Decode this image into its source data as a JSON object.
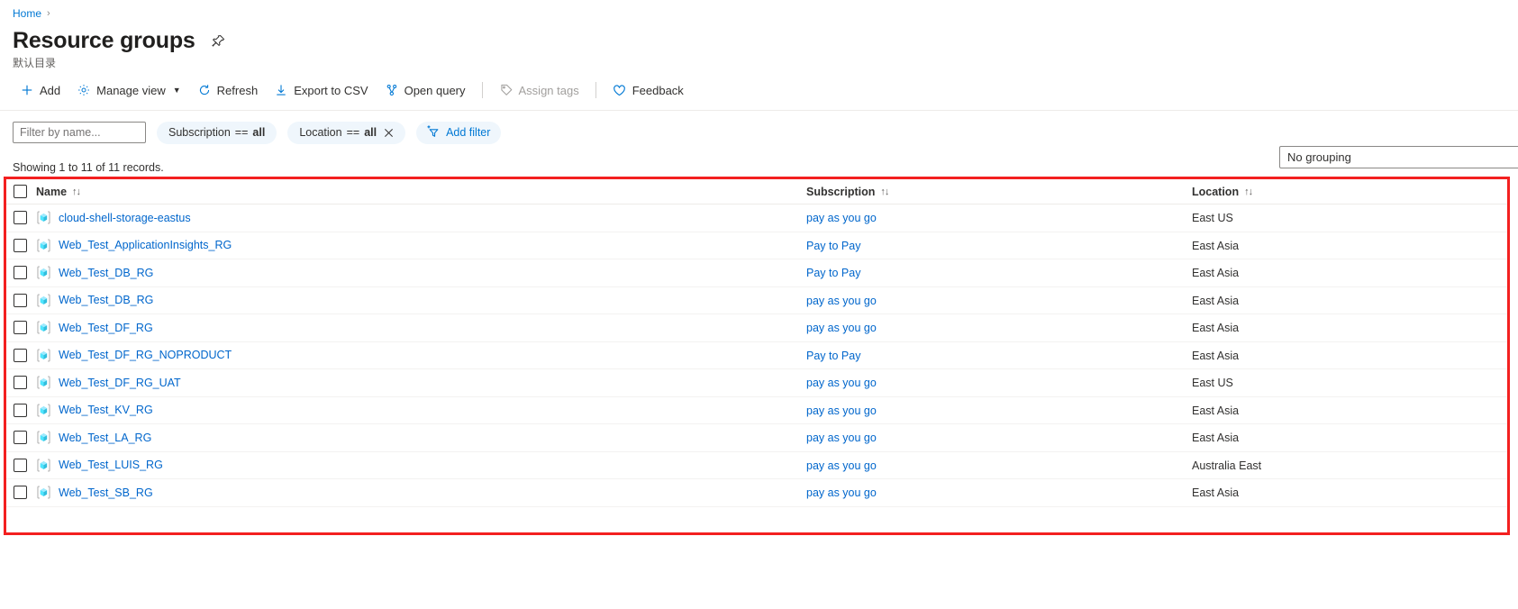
{
  "breadcrumb": {
    "home": "Home",
    "separator": "›"
  },
  "header": {
    "title": "Resource groups",
    "subtitle": "默认目录",
    "pin_icon": "pin-icon"
  },
  "toolbar": {
    "add": "Add",
    "manage_view": "Manage view",
    "refresh": "Refresh",
    "export_csv": "Export to CSV",
    "open_query": "Open query",
    "assign_tags": "Assign tags",
    "feedback": "Feedback"
  },
  "filters": {
    "name_placeholder": "Filter by name...",
    "name_value": "",
    "subscription_pill": {
      "field": "Subscription",
      "op": "==",
      "value": "all"
    },
    "location_pill": {
      "field": "Location",
      "op": "==",
      "value": "all"
    },
    "add_filter": "Add filter"
  },
  "status": {
    "records": "Showing 1 to 11 of 11 records.",
    "grouping": "No grouping"
  },
  "colors": {
    "accent": "#0078d4",
    "link": "#0066cc",
    "highlight_border": "#f32020",
    "pill_bg": "#eff6fc",
    "resource_icon": "#50e6ff"
  },
  "table": {
    "columns": [
      {
        "key": "name",
        "label": "Name",
        "sortable": true
      },
      {
        "key": "subscription",
        "label": "Subscription",
        "sortable": true
      },
      {
        "key": "location",
        "label": "Location",
        "sortable": true
      }
    ],
    "rows": [
      {
        "name": "cloud-shell-storage-eastus",
        "subscription": "pay as you go",
        "location": "East US"
      },
      {
        "name": "Web_Test_ApplicationInsights_RG",
        "subscription": "Pay to Pay",
        "location": "East Asia"
      },
      {
        "name": "Web_Test_DB_RG",
        "subscription": "Pay to Pay",
        "location": "East Asia"
      },
      {
        "name": "Web_Test_DB_RG",
        "subscription": "pay as you go",
        "location": "East Asia"
      },
      {
        "name": "Web_Test_DF_RG",
        "subscription": "pay as you go",
        "location": "East Asia"
      },
      {
        "name": "Web_Test_DF_RG_NOPRODUCT",
        "subscription": "Pay to Pay",
        "location": "East Asia"
      },
      {
        "name": "Web_Test_DF_RG_UAT",
        "subscription": "pay as you go",
        "location": "East US"
      },
      {
        "name": "Web_Test_KV_RG",
        "subscription": "pay as you go",
        "location": "East Asia"
      },
      {
        "name": "Web_Test_LA_RG",
        "subscription": "pay as you go",
        "location": "East Asia"
      },
      {
        "name": "Web_Test_LUIS_RG",
        "subscription": "pay as you go",
        "location": "Australia East"
      },
      {
        "name": "Web_Test_SB_RG",
        "subscription": "pay as you go",
        "location": "East Asia"
      }
    ]
  }
}
